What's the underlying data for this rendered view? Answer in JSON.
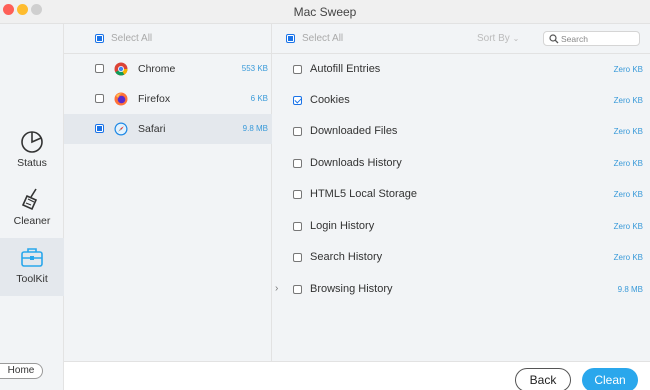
{
  "window": {
    "title": "Mac Sweep"
  },
  "sidebar": {
    "items": [
      {
        "label": "Status",
        "icon": "pie-chart-icon"
      },
      {
        "label": "Cleaner",
        "icon": "broom-icon"
      },
      {
        "label": "ToolKit",
        "icon": "toolbox-icon",
        "active": true
      }
    ],
    "home_label": "Home"
  },
  "browsers": {
    "select_all_label": "Select All",
    "items": [
      {
        "name": "Chrome",
        "size": "553 KB",
        "icon": "chrome-icon"
      },
      {
        "name": "Firefox",
        "size": "6 KB",
        "icon": "firefox-icon"
      },
      {
        "name": "Safari",
        "size": "9.8 MB",
        "icon": "safari-icon",
        "selected": true
      }
    ]
  },
  "items_panel": {
    "select_all_label": "Select All",
    "sort_label": "Sort By",
    "search_placeholder": "Search",
    "items": [
      {
        "name": "Autofill Entries",
        "size": "Zero KB",
        "checked": false
      },
      {
        "name": "Cookies",
        "size": "Zero KB",
        "checked": true
      },
      {
        "name": "Downloaded Files",
        "size": "Zero KB",
        "checked": false
      },
      {
        "name": "Downloads History",
        "size": "Zero KB",
        "checked": false
      },
      {
        "name": "HTML5 Local Storage",
        "size": "Zero KB",
        "checked": false
      },
      {
        "name": "Login History",
        "size": "Zero KB",
        "checked": false
      },
      {
        "name": "Search History",
        "size": "Zero KB",
        "checked": false
      },
      {
        "name": "Browsing History",
        "size": "9.8 MB",
        "checked": false,
        "expandable": true
      }
    ]
  },
  "footer": {
    "back_label": "Back",
    "clean_label": "Clean"
  },
  "colors": {
    "accent": "#2aa7ec",
    "size_text": "#3a9ad9",
    "checkbox": "#1a73e8"
  }
}
